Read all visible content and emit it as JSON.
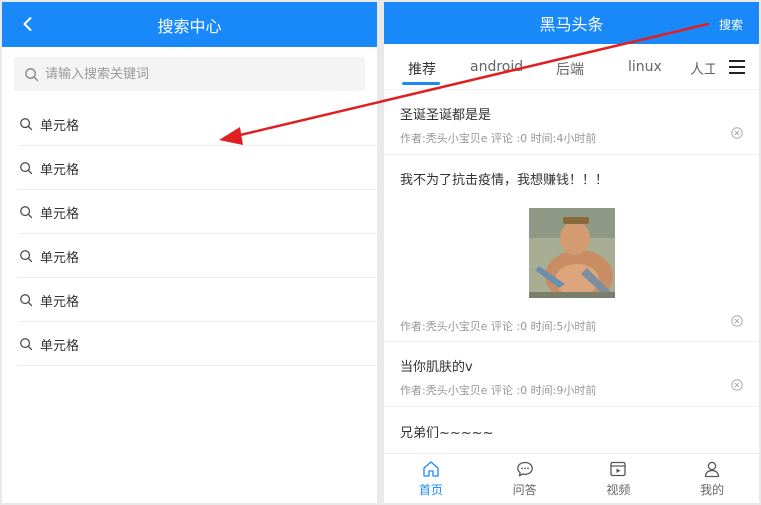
{
  "search_page": {
    "title": "搜索中心",
    "placeholder": "请输入搜索关键词",
    "suggestions": [
      "单元格",
      "单元格",
      "单元格",
      "单元格",
      "单元格",
      "单元格"
    ]
  },
  "home_page": {
    "title": "黑马头条",
    "search_label": "搜索",
    "tabs": [
      "推荐",
      "android",
      "后端",
      "linux",
      "人工智能"
    ],
    "articles": [
      {
        "title": "圣诞圣诞都是是",
        "meta": "作者:秃头小宝贝e 评论 :0 时间:4小时前"
      },
      {
        "title": "我不为了抗击疫情，我想赚钱！！！",
        "meta": "作者:秃头小宝贝e 评论 :0 时间:5小时前"
      },
      {
        "title": "当你肌肤的v",
        "meta": "作者:秃头小宝贝e 评论 :0 时间:9小时前"
      },
      {
        "title": "兄弟们~~~~~",
        "meta": ""
      }
    ],
    "tabbar": [
      {
        "label": "首页",
        "icon": "home-icon"
      },
      {
        "label": "问答",
        "icon": "chat-icon"
      },
      {
        "label": "视频",
        "icon": "video-icon"
      },
      {
        "label": "我的",
        "icon": "user-icon"
      }
    ]
  },
  "colors": {
    "primary": "#1989fa",
    "annotation_arrow": "#e02020"
  }
}
